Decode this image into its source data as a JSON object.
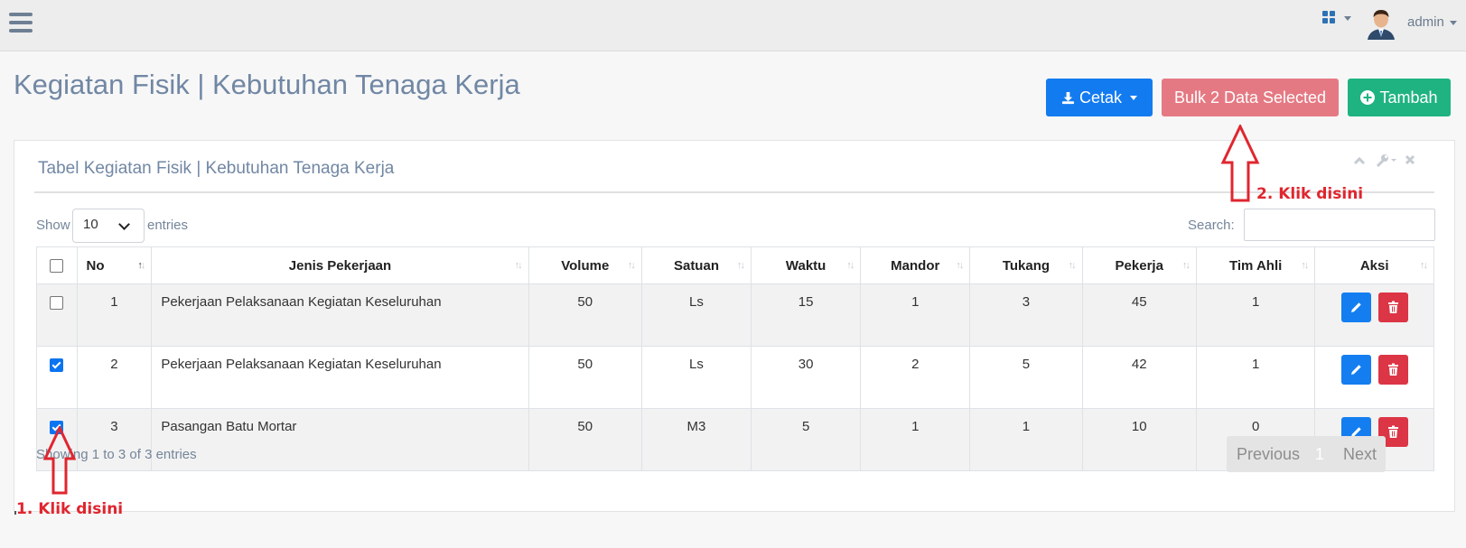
{
  "navbar": {
    "user_name": "admin"
  },
  "header": {
    "title": "Kegiatan Fisik | Kebutuhan Tenaga Kerja",
    "buttons": {
      "cetak": "Cetak",
      "bulk": "Bulk 2 Data Selected",
      "tambah": "Tambah"
    }
  },
  "card": {
    "title": "Tabel Kegiatan Fisik | Kebutuhan Tenaga Kerja",
    "show_label": "Show",
    "page_length": "10",
    "entries_label": "entries",
    "search_label": "Search:",
    "search_value": ""
  },
  "table": {
    "columns": [
      "No",
      "Jenis Pekerjaan",
      "Volume",
      "Satuan",
      "Waktu",
      "Mandor",
      "Tukang",
      "Pekerja",
      "Tim Ahli",
      "Aksi"
    ],
    "rows": [
      {
        "checked": false,
        "no": "1",
        "jenis": "Pekerjaan Pelaksanaan Kegiatan Keseluruhan",
        "volume": "50",
        "satuan": "Ls",
        "waktu": "15",
        "mandor": "1",
        "tukang": "3",
        "pekerja": "45",
        "tim_ahli": "1"
      },
      {
        "checked": true,
        "no": "2",
        "jenis": "Pekerjaan Pelaksanaan Kegiatan Keseluruhan",
        "volume": "50",
        "satuan": "Ls",
        "waktu": "30",
        "mandor": "2",
        "tukang": "5",
        "pekerja": "42",
        "tim_ahli": "1"
      },
      {
        "checked": true,
        "no": "3",
        "jenis": "Pasangan Batu Mortar",
        "volume": "50",
        "satuan": "M3",
        "waktu": "5",
        "mandor": "1",
        "tukang": "1",
        "pekerja": "10",
        "tim_ahli": "0"
      }
    ]
  },
  "footer": {
    "info": "Showing 1 to 3 of 3 entries",
    "previous": "Previous",
    "page": "1",
    "next": "Next"
  },
  "annotations": {
    "step1": "1. Klik disini",
    "step2": "2. Klik disini"
  },
  "colors": {
    "primary": "#137bf0",
    "bulk": "#e57983",
    "success": "#1fb381",
    "danger": "#dc3545",
    "annotation": "#e0262f"
  },
  "icons": [
    "menu-icon",
    "apps-grid-icon",
    "user-avatar-icon",
    "download-icon",
    "plus-circle-icon",
    "chevron-up-icon",
    "wrench-icon",
    "close-icon",
    "pencil-icon",
    "trash-icon",
    "sort-icon"
  ]
}
